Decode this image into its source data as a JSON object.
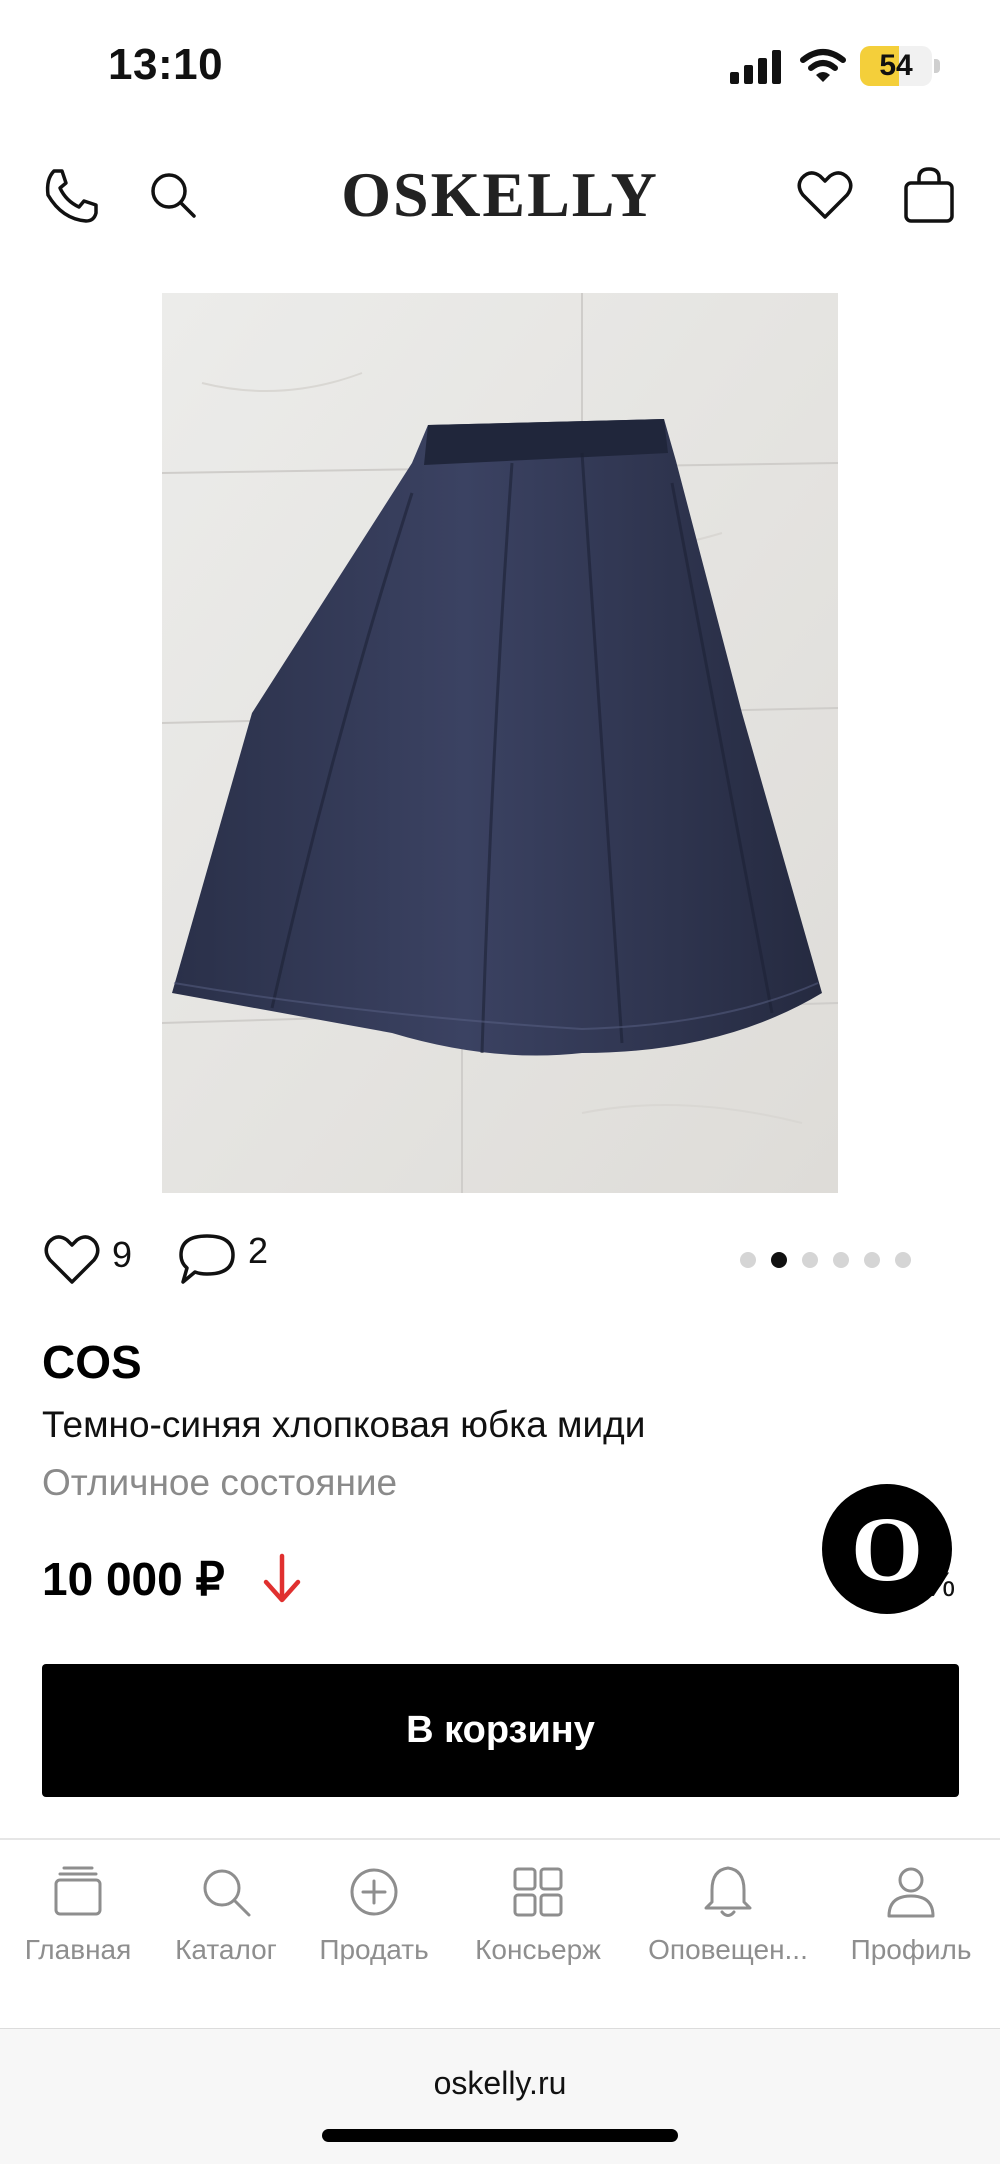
{
  "status_bar": {
    "time": "13:10",
    "battery_level": "54",
    "battery_fraction": 0.54
  },
  "header": {
    "logo": "OSKELLY"
  },
  "product": {
    "likes": "9",
    "comments": "2",
    "photo_count": 6,
    "active_photo_index": 1,
    "brand": "COS",
    "title": "Темно-синяя хлопковая юбка миди",
    "condition": "Отличное состояние",
    "price": "10 000 ₽",
    "price_trend": "down",
    "partial_text": "%",
    "cart_button": "В корзину"
  },
  "concierge_badge": "O",
  "tabbar": {
    "items": [
      {
        "label": "Главная",
        "icon": "home-icon"
      },
      {
        "label": "Каталог",
        "icon": "search-icon"
      },
      {
        "label": "Продать",
        "icon": "plus-circle-icon"
      },
      {
        "label": "Консьерж",
        "icon": "grid-icon"
      },
      {
        "label": "Оповещен...",
        "icon": "bell-icon"
      },
      {
        "label": "Профиль",
        "icon": "profile-icon"
      }
    ]
  },
  "browser": {
    "url": "oskelly.ru"
  },
  "colors": {
    "accent": "#000000",
    "price_down": "#e0302f",
    "muted_text": "#8a8a8a",
    "battery": "#f4cf3a"
  }
}
